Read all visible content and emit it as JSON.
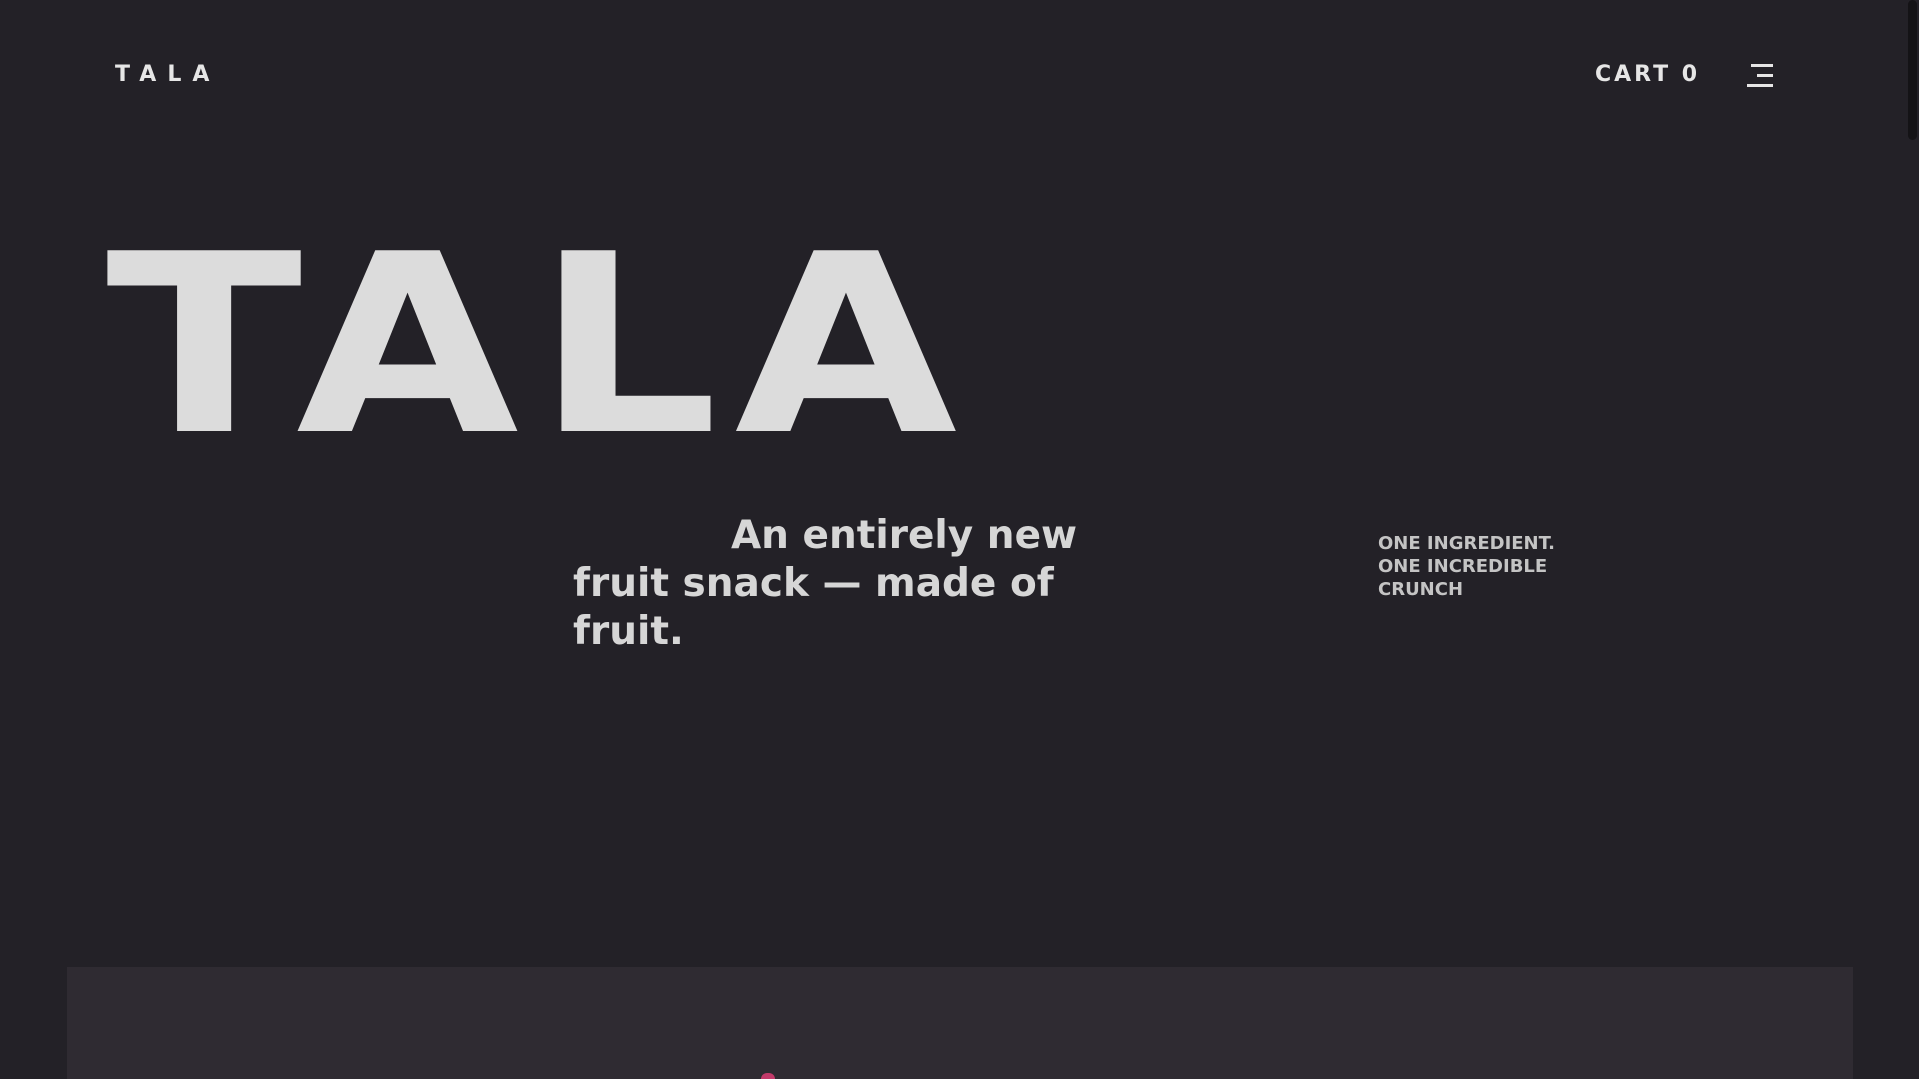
{
  "header": {
    "logo": "TALA",
    "cart_label": "CART 0",
    "menu_icon": "hamburger-menu-icon"
  },
  "hero": {
    "title": "TALA",
    "tagline": "An entirely new fruit snack — made of fruit.",
    "side_note_lines": [
      "ONE INGREDIENT.",
      "ONE INCREDIBLE",
      "CRUNCH"
    ]
  },
  "colors": {
    "background": "#232127",
    "text": "#dcdcdc",
    "panel": "#2f2b32",
    "accent": "#c23a6a"
  }
}
